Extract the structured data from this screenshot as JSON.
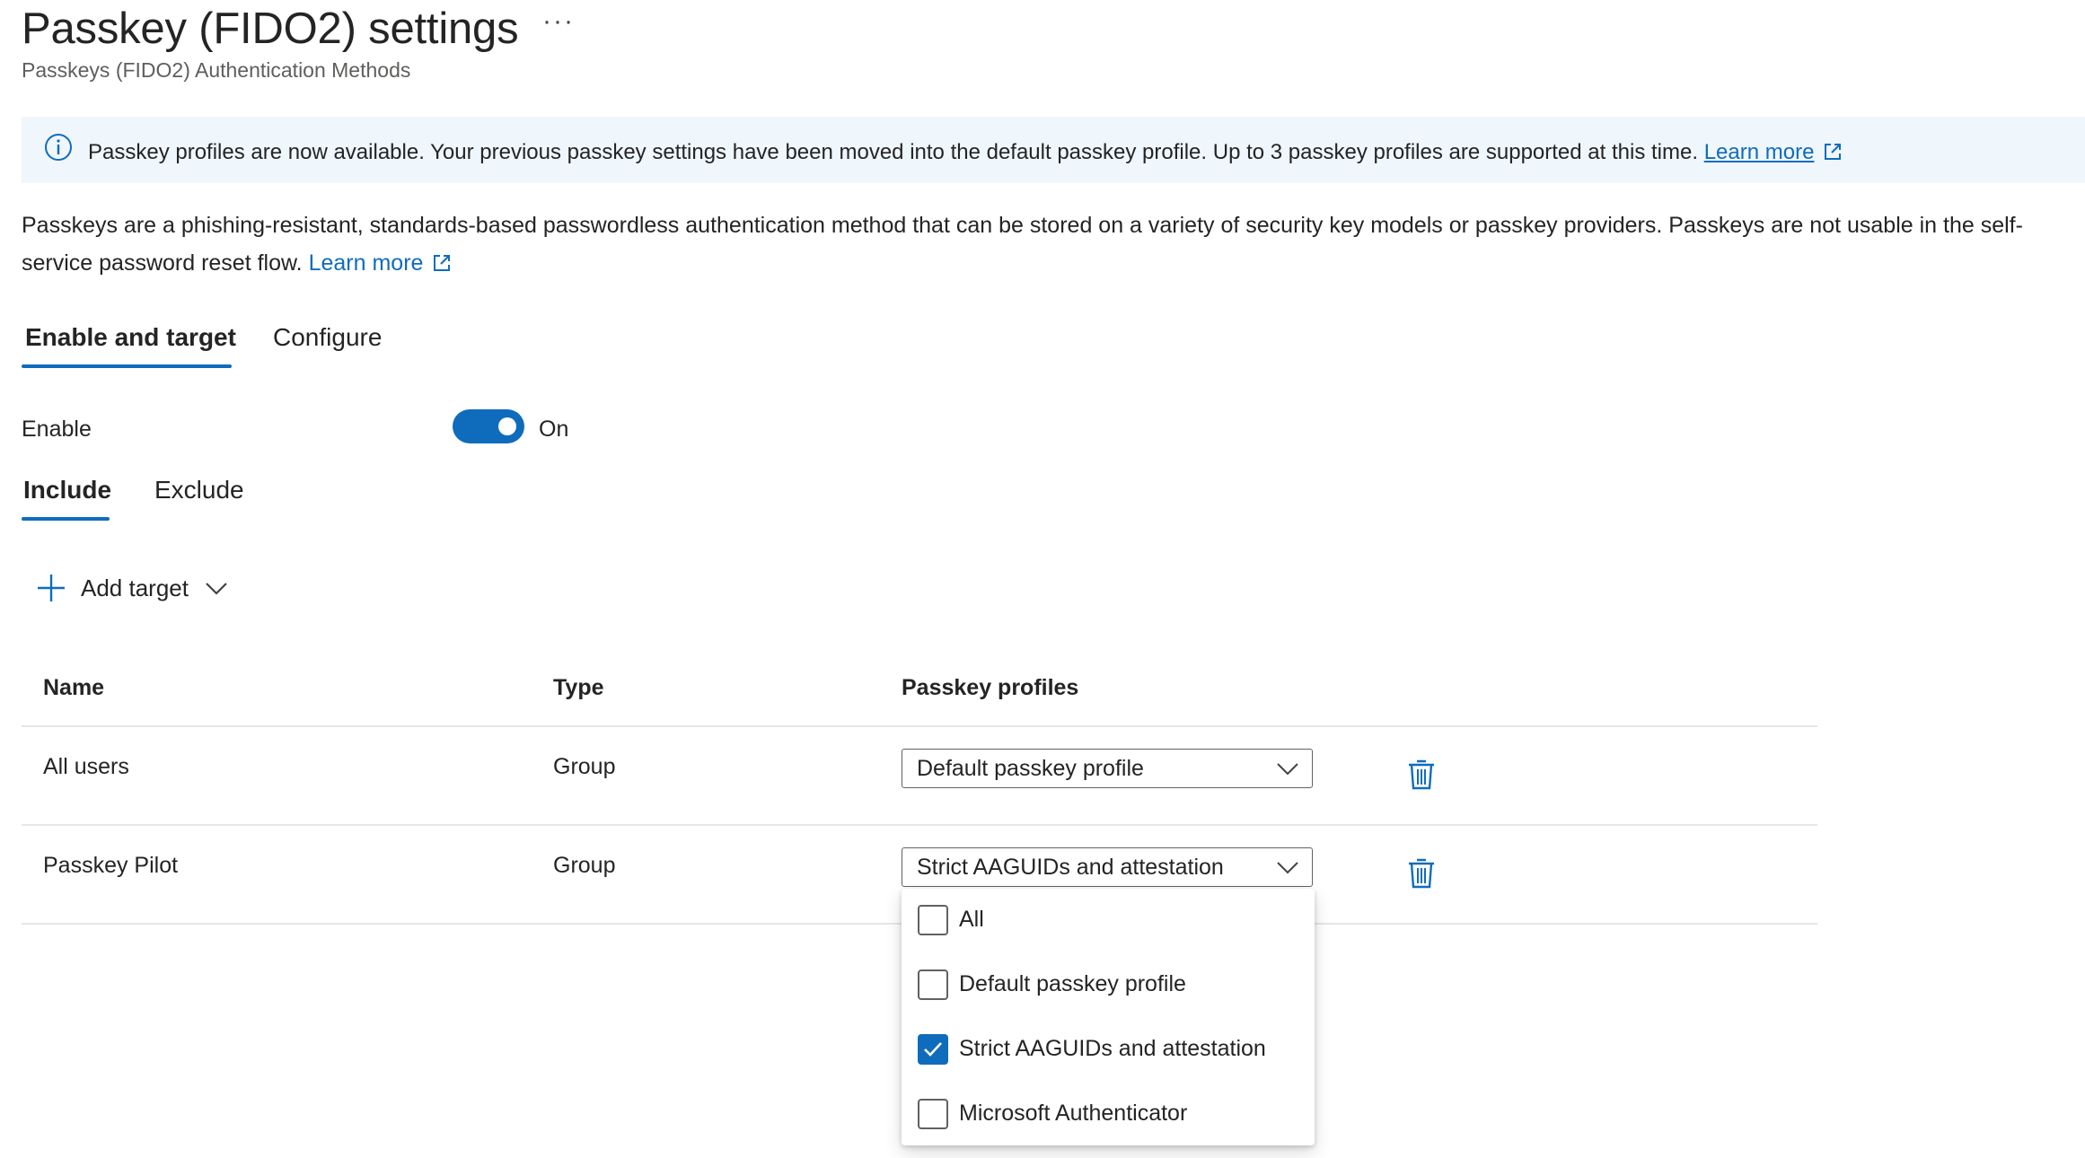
{
  "page": {
    "title": "Passkey (FIDO2) settings",
    "more_label": "···",
    "subtitle": "Passkeys (FIDO2) Authentication Methods"
  },
  "banner": {
    "icon": "info-icon",
    "text": "Passkey profiles are now available. Your previous passkey settings have been moved into the default passkey profile. Up to 3 passkey profiles are supported at this time.",
    "link": "Learn more"
  },
  "description": {
    "text": "Passkeys are a phishing-resistant, standards-based passwordless authentication method that can be stored on a variety of security key models or passkey providers. Passkeys are not usable in the self-service password reset flow.",
    "link": "Learn more"
  },
  "tabs": [
    {
      "label": "Enable and target",
      "active": true
    },
    {
      "label": "Configure",
      "active": false
    }
  ],
  "enable": {
    "label": "Enable",
    "state": "On",
    "on": true
  },
  "subtabs": [
    {
      "label": "Include",
      "active": true
    },
    {
      "label": "Exclude",
      "active": false
    }
  ],
  "add_target": {
    "label": "Add target"
  },
  "table": {
    "headers": [
      "Name",
      "Type",
      "Passkey profiles"
    ],
    "rows": [
      {
        "name": "All users",
        "type": "Group",
        "profile": "Default passkey profile"
      },
      {
        "name": "Passkey Pilot",
        "type": "Group",
        "profile": "Strict AAGUIDs and attestation"
      }
    ]
  },
  "dropdown": {
    "options": [
      {
        "label": "All",
        "checked": false
      },
      {
        "label": "Default passkey profile",
        "checked": false
      },
      {
        "label": "Strict AAGUIDs and attestation",
        "checked": true
      },
      {
        "label": "Microsoft Authenticator",
        "checked": false
      }
    ]
  },
  "colors": {
    "accent": "#0f6cbd",
    "banner_bg": "#eff6fc",
    "text": "#242424",
    "muted": "#605e5c"
  }
}
